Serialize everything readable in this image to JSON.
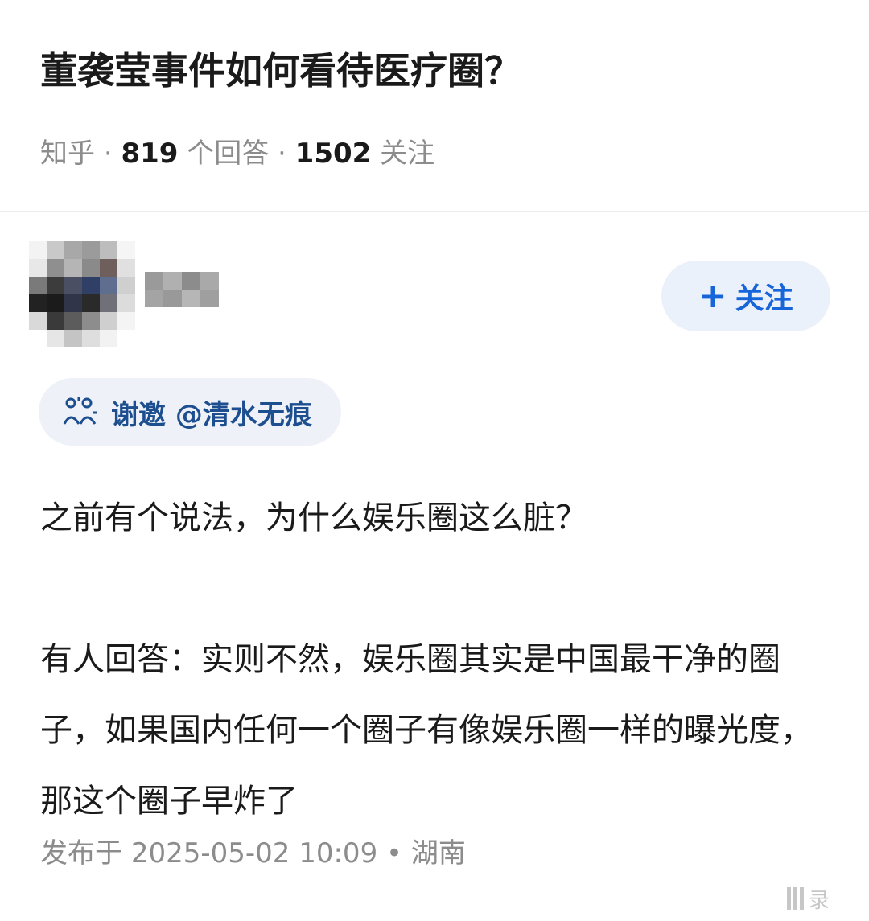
{
  "question": {
    "title": "董袭莹事件如何看待医疗圈？",
    "source": "知乎",
    "sep1": "·",
    "answer_count": "819",
    "answer_unit": "个回答",
    "sep2": "·",
    "follower_count": "1502",
    "follower_unit": "关注"
  },
  "author": {
    "follow_icon": "plus-icon",
    "follow_plus": "+",
    "follow_label": "关注"
  },
  "invite": {
    "icon": "invite-icon",
    "label": "谢邀 @清水无痕"
  },
  "answer": {
    "paragraph1": "之前有个说法，为什么娱乐圈这么脏？",
    "paragraph2": "有人回答：实则不然，娱乐圈其实是中国最干净的圈子，如果国内任何一个圈子有像娱乐圈一样的曝光度，那这个圈子早炸了"
  },
  "publish": {
    "prefix": "发布于",
    "datetime": "2025-05-02 10:09",
    "dot": "•",
    "location": "湖南"
  },
  "watermark": {
    "text": "录"
  },
  "colors": {
    "accent": "#1765d8",
    "follow_bg": "#ebf1fa",
    "invite_bg": "#eef2f8",
    "invite_text": "#1d4e8f",
    "meta_gray": "#8c8c8c",
    "text": "#1a1a1a"
  }
}
